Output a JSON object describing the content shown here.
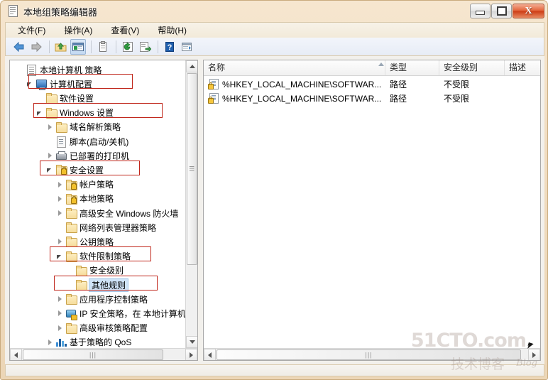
{
  "window": {
    "title": "本地组策略编辑器",
    "icon": "policy-document-icon",
    "controls": {
      "minimize": "最小化",
      "maximize": "最大化",
      "close": "X"
    }
  },
  "menubar": {
    "items": [
      {
        "label": "文件(F)",
        "name": "menu-file"
      },
      {
        "label": "操作(A)",
        "name": "menu-action"
      },
      {
        "label": "查看(V)",
        "name": "menu-view"
      },
      {
        "label": "帮助(H)",
        "name": "menu-help"
      }
    ]
  },
  "toolbar": {
    "buttons": [
      {
        "name": "back-arrow-icon",
        "glyph": "←"
      },
      {
        "name": "forward-arrow-icon",
        "glyph": "→"
      },
      {
        "name": "up-folder-icon",
        "glyph": "↑"
      },
      {
        "name": "show-hide-tree-icon",
        "glyph": "▤"
      },
      {
        "name": "clipboard-icon",
        "glyph": "ὌB"
      },
      {
        "name": "refresh-icon",
        "glyph": "↻"
      },
      {
        "name": "export-list-icon",
        "glyph": "↳"
      },
      {
        "name": "help-icon",
        "glyph": "?"
      },
      {
        "name": "properties-icon",
        "glyph": "▥"
      }
    ]
  },
  "tree": {
    "items": [
      {
        "label": "本地计算机 策略",
        "indent": 0,
        "twisty": "none",
        "icon": "policy-document-icon",
        "selected": false,
        "highlight": false
      },
      {
        "label": "计算机配置",
        "indent": 1,
        "twisty": "expanded",
        "icon": "computer-monitor-icon",
        "selected": false,
        "highlight": true
      },
      {
        "label": "软件设置",
        "indent": 2,
        "twisty": "none",
        "icon": "folder-icon",
        "selected": false,
        "highlight": false
      },
      {
        "label": "Windows 设置",
        "indent": 2,
        "twisty": "expanded",
        "icon": "folder-icon",
        "selected": false,
        "highlight": true
      },
      {
        "label": "域名解析策略",
        "indent": 3,
        "twisty": "collapsed",
        "icon": "folder-icon",
        "selected": false,
        "highlight": false
      },
      {
        "label": "脚本(启动/关机)",
        "indent": 3,
        "twisty": "none",
        "icon": "script-icon",
        "selected": false,
        "highlight": false
      },
      {
        "label": "已部署的打印机",
        "indent": 3,
        "twisty": "collapsed",
        "icon": "printer-icon",
        "selected": false,
        "highlight": false
      },
      {
        "label": "安全设置",
        "indent": 3,
        "twisty": "expanded",
        "icon": "lock-folder-icon",
        "selected": false,
        "highlight": true
      },
      {
        "label": "帐户策略",
        "indent": 4,
        "twisty": "collapsed",
        "icon": "lock-folder-icon",
        "selected": false,
        "highlight": false
      },
      {
        "label": "本地策略",
        "indent": 4,
        "twisty": "collapsed",
        "icon": "lock-folder-icon",
        "selected": false,
        "highlight": false
      },
      {
        "label": "高级安全 Windows 防火墙",
        "indent": 4,
        "twisty": "collapsed",
        "icon": "folder-icon",
        "selected": false,
        "highlight": false
      },
      {
        "label": "网络列表管理器策略",
        "indent": 4,
        "twisty": "none",
        "icon": "folder-icon",
        "selected": false,
        "highlight": false
      },
      {
        "label": "公钥策略",
        "indent": 4,
        "twisty": "collapsed",
        "icon": "folder-icon",
        "selected": false,
        "highlight": false
      },
      {
        "label": "软件限制策略",
        "indent": 4,
        "twisty": "expanded",
        "icon": "folder-icon",
        "selected": false,
        "highlight": true
      },
      {
        "label": "安全级别",
        "indent": 5,
        "twisty": "none",
        "icon": "folder-icon",
        "selected": false,
        "highlight": false
      },
      {
        "label": "其他规则",
        "indent": 5,
        "twisty": "none",
        "icon": "folder-icon",
        "selected": true,
        "highlight": true
      },
      {
        "label": "应用程序控制策略",
        "indent": 4,
        "twisty": "collapsed",
        "icon": "folder-icon",
        "selected": false,
        "highlight": false
      },
      {
        "label": "IP 安全策略，在 本地计算机",
        "indent": 4,
        "twisty": "collapsed",
        "icon": "ipsec-icon",
        "selected": false,
        "highlight": false
      },
      {
        "label": "高级审核策略配置",
        "indent": 4,
        "twisty": "collapsed",
        "icon": "folder-icon",
        "selected": false,
        "highlight": false
      },
      {
        "label": "基于策略的 QoS",
        "indent": 3,
        "twisty": "collapsed",
        "icon": "bar-chart-icon",
        "selected": false,
        "highlight": false
      }
    ]
  },
  "list": {
    "columns": [
      {
        "label": "名称",
        "name": "column-name"
      },
      {
        "label": "类型",
        "name": "column-type"
      },
      {
        "label": "安全级别",
        "name": "column-security-level"
      },
      {
        "label": "描述",
        "name": "column-description"
      }
    ],
    "rows": [
      {
        "name": "%HKEY_LOCAL_MACHINE\\SOFTWAR...",
        "type": "路径",
        "level": "不受限",
        "description": ""
      },
      {
        "name": "%HKEY_LOCAL_MACHINE\\SOFTWAR...",
        "type": "路径",
        "level": "不受限",
        "description": ""
      }
    ]
  },
  "watermark": {
    "main": "51CTO.com",
    "sub": "技术博客",
    "blog": "Blog"
  },
  "colors": {
    "annotation": "#c0261b",
    "selection": "#cfe3f7",
    "close": "#cd3d16"
  }
}
